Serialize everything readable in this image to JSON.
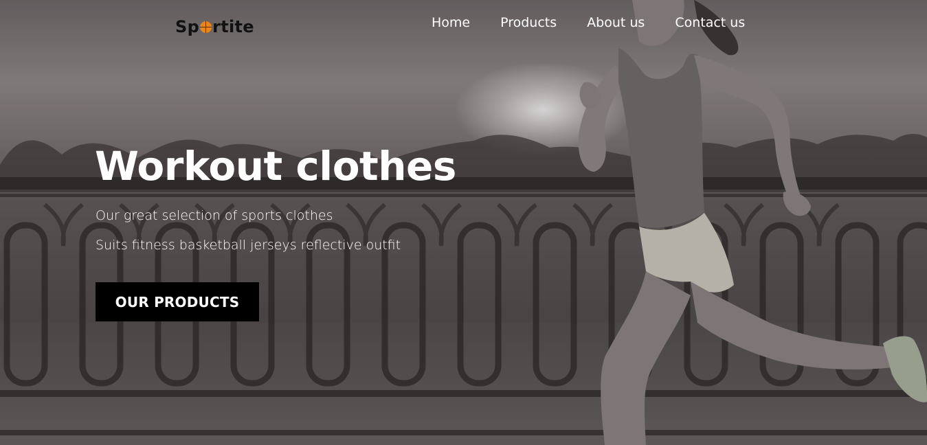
{
  "brand": {
    "name_prefix": "Sp",
    "name_suffix": "rtite",
    "logo_accent_color": "#e8861e",
    "logo_icon": "basketball-icon"
  },
  "nav": {
    "items": [
      {
        "label": "Home"
      },
      {
        "label": "Products"
      },
      {
        "label": "About us"
      },
      {
        "label": "Contact us"
      }
    ]
  },
  "hero": {
    "headline": "Workout clothes",
    "subtitle_1": "Our great selection of sports clothes",
    "subtitle_2": "Suits fitness basketball jerseys reflective outfit",
    "cta_label": "OUR PRODUCTS",
    "image_subject": "woman-running-on-bridge-photo"
  }
}
